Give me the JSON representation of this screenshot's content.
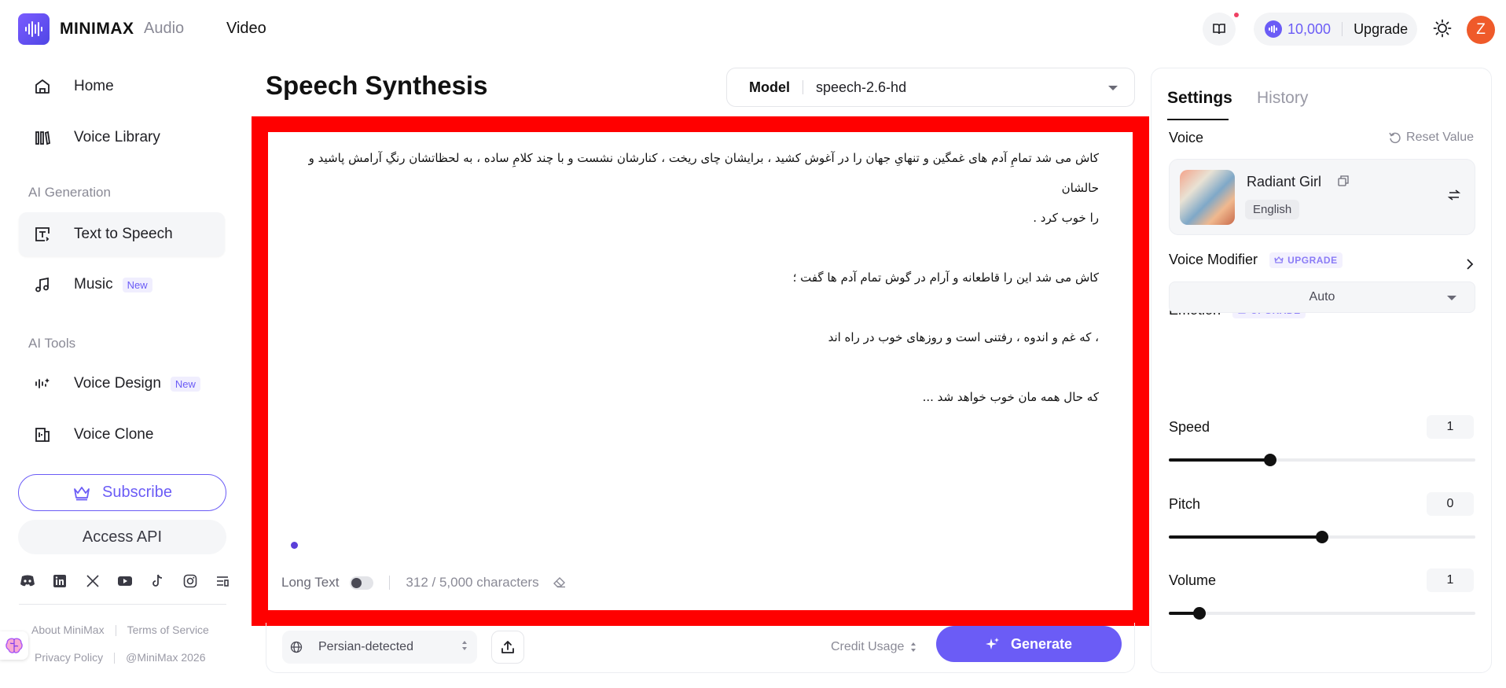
{
  "header": {
    "brand": "MINIMAX",
    "nav": [
      "Audio",
      "Video"
    ],
    "credits": "10,000",
    "upgrade": "Upgrade",
    "avatar_initial": "Z"
  },
  "sidebar": {
    "items": [
      {
        "label": "Home",
        "icon": "home-icon"
      },
      {
        "label": "Voice Library",
        "icon": "library-icon"
      }
    ],
    "section_ai_generation": "AI Generation",
    "ai_generation": [
      {
        "label": "Text to Speech",
        "icon": "text-to-speech-icon",
        "active": true
      },
      {
        "label": "Music",
        "icon": "music-icon",
        "badge": "New"
      }
    ],
    "section_ai_tools": "AI Tools",
    "ai_tools": [
      {
        "label": "Voice Design",
        "icon": "voice-design-icon",
        "badge": "New"
      },
      {
        "label": "Voice Clone",
        "icon": "voice-clone-icon"
      }
    ],
    "subscribe": "Subscribe",
    "access_api": "Access API",
    "socials": [
      "discord-icon",
      "linkedin-icon",
      "x-icon",
      "youtube-icon",
      "tiktok-icon",
      "instagram-icon",
      "news-icon"
    ],
    "footer": {
      "about": "About MiniMax",
      "terms": "Terms of Service",
      "privacy": "Privacy Policy",
      "copyright": "@MiniMax 2026"
    }
  },
  "main": {
    "title": "Speech Synthesis",
    "model_label": "Model",
    "model_value": "speech-2.6-hd",
    "text_lines": [
      "کاش می شد تمامِ آدم های غمگین و تنهایِ جهان را در آغوش کشید ، برایشان چای ریخت ، کنارشان نشست و با چند کلامِ ساده ، به لحظاتشان رنگِ آرامش پاشید و حالشان",
      "را خوب کرد .",
      "",
      "کاش می شد این را قاطعانه و آرام در گوش تمام آدم ها گفت ؛",
      "",
      "، که غم و اندوه ، رفتنی است و روزهای خوب در راه اند",
      "",
      "که حال همه مان خوب خواهد شد ..."
    ],
    "long_text_label": "Long Text",
    "long_text_on": false,
    "char_count": "312 / 5,000 characters",
    "language": "Persian-detected",
    "credit_usage": "Credit Usage",
    "generate": "Generate"
  },
  "settings": {
    "tab_settings": "Settings",
    "tab_history": "History",
    "voice_label": "Voice",
    "reset": "Reset Value",
    "voice_name": "Radiant Girl",
    "voice_lang": "English",
    "voice_modifier": "Voice Modifier",
    "upgrade_chip": "UPGRADE",
    "emotion": "Emotion",
    "emotion_value": "Auto",
    "speed_label": "Speed",
    "speed_value": "1",
    "speed_fraction": 0.33,
    "pitch_label": "Pitch",
    "pitch_value": "0",
    "pitch_fraction": 0.5,
    "volume_label": "Volume",
    "volume_value": "1",
    "volume_fraction": 0.1
  },
  "colors": {
    "accent": "#6b5cf6",
    "highlight_frame": "#ff0000"
  }
}
